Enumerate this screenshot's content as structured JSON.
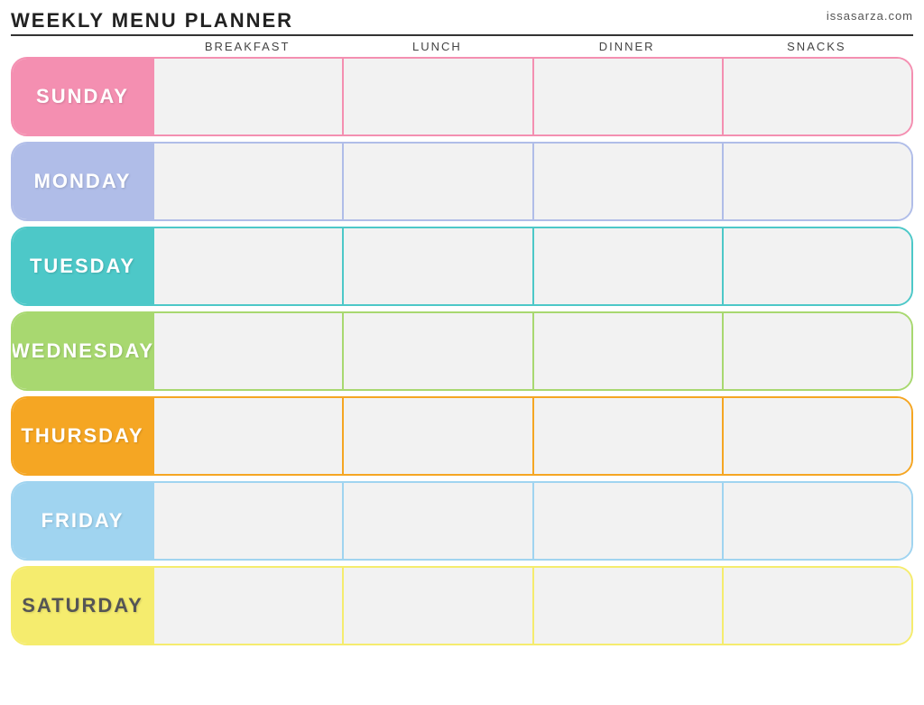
{
  "header": {
    "title": "Weekly Menu Planner",
    "site": "issasarza.com"
  },
  "columns": {
    "empty": "",
    "breakfast": "Breakfast",
    "lunch": "Lunch",
    "dinner": "Dinner",
    "snacks": "Snacks"
  },
  "days": [
    {
      "id": "sunday",
      "label": "Sunday",
      "class": "row-sunday"
    },
    {
      "id": "monday",
      "label": "Monday",
      "class": "row-monday"
    },
    {
      "id": "tuesday",
      "label": "Tuesday",
      "class": "row-tuesday"
    },
    {
      "id": "wednesday",
      "label": "Wednesday",
      "class": "row-wednesday"
    },
    {
      "id": "thursday",
      "label": "Thursday",
      "class": "row-thursday"
    },
    {
      "id": "friday",
      "label": "Friday",
      "class": "row-friday"
    },
    {
      "id": "saturday",
      "label": "Saturday",
      "class": "row-saturday"
    }
  ]
}
